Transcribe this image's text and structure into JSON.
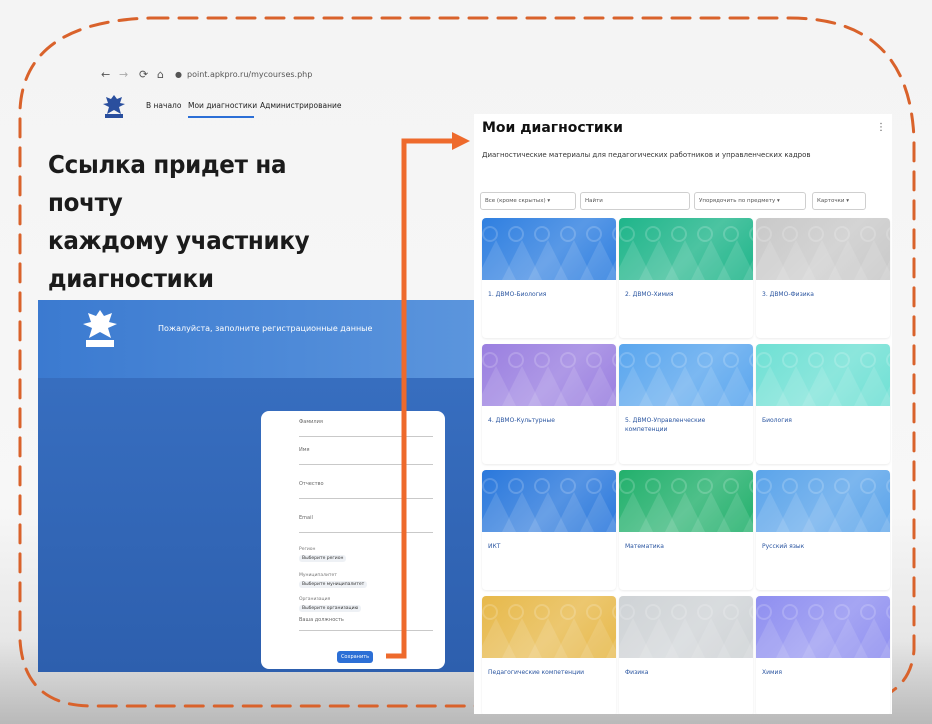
{
  "caption": {
    "line1": "Ссылка придет на почту",
    "line2": "каждому участнику",
    "line3": "диагностики"
  },
  "browser": {
    "url": "point.apkpro.ru/mycourses.php",
    "nav_back": "←",
    "nav_forward": "→",
    "nav_reload": "⟳",
    "nav_home": "⌂"
  },
  "site_nav": {
    "home": "В начало",
    "my_diagnostics": "Мои диагностики",
    "admin": "Администрирование"
  },
  "registration": {
    "title": "Пожалуйста, заполните регистрационные данные",
    "fields": [
      "Фамилия",
      "Имя",
      "Отчество",
      "Email"
    ],
    "region_label": "Регион",
    "region_value": "Выберите регион",
    "municipality_label": "Муниципалитет",
    "municipality_value": "Выберите муниципалитет",
    "org_label": "Организация",
    "org_value": "Выберите организацию",
    "position_label": "Ваша должность",
    "submit": "Сохранить"
  },
  "diagnostics": {
    "title": "Мои диагностики",
    "more": "⋮",
    "subtitle": "Диагностические материалы для педагогических работников и управленческих кадров",
    "filters": {
      "all": "Все (кроме скрытых)",
      "search_placeholder": "Найти",
      "sort": "Упорядочить по предмету",
      "view": "Карточки"
    },
    "tiles": [
      {
        "label": "1. ДВМО-Биология",
        "color": "#2f7fe0"
      },
      {
        "label": "2. ДВМО-Химия",
        "color": "#1fb58a"
      },
      {
        "label": "3. ДВМО-Физика",
        "color": "#c9c9c9"
      },
      {
        "label": "4. ДВМО-Культурные",
        "color": "#9a7fe0"
      },
      {
        "label": "5. ДВМО-Управленческие компетенции",
        "color": "#5aa6ee"
      },
      {
        "label": "Биология",
        "color": "#6fe0d4"
      },
      {
        "label": "ИКТ",
        "color": "#2a78dc"
      },
      {
        "label": "Математика",
        "color": "#22b06c"
      },
      {
        "label": "Русский язык",
        "color": "#5ba4ea"
      },
      {
        "label": "Педагогические компетенции",
        "color": "#e7b94b"
      },
      {
        "label": "Физика",
        "color": "#cfd3d6"
      },
      {
        "label": "Химия",
        "color": "#8f8ff0"
      }
    ]
  },
  "colors": {
    "frame": "#d9622b",
    "arrow": "#ee6a2c",
    "accent": "#2c6fd6"
  }
}
